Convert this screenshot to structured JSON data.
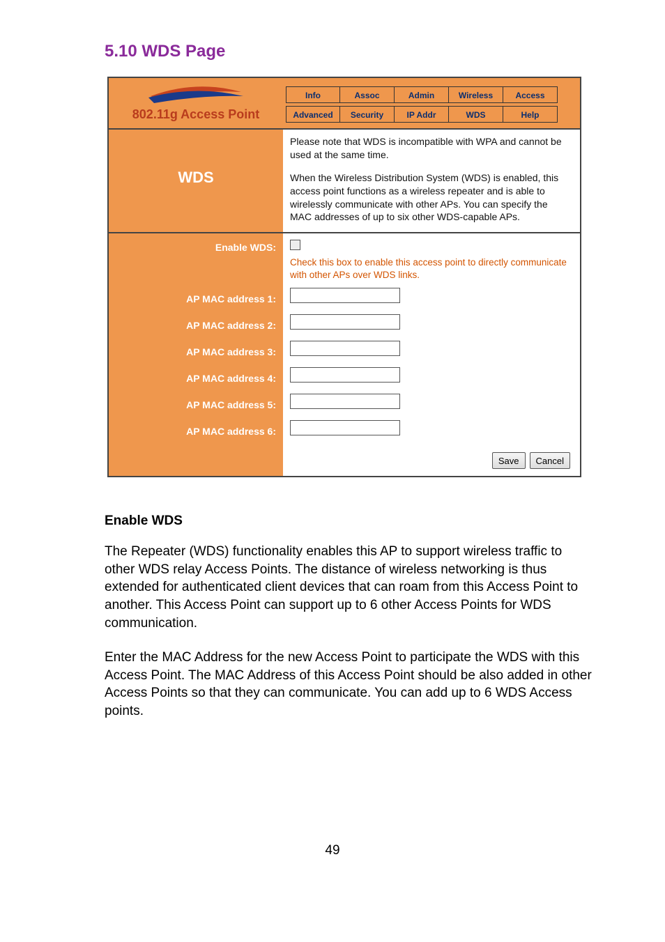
{
  "page_title": "5.10 WDS Page",
  "logo_text": "802.11g Access Point",
  "tabs": {
    "row1": [
      "Info",
      "Assoc",
      "Admin",
      "Wireless",
      "Access"
    ],
    "row2": [
      "Advanced",
      "Security",
      "IP Addr",
      "WDS",
      "Help"
    ]
  },
  "wds_section": {
    "heading": "WDS",
    "note": "Please note that WDS is incompatible with WPA and cannot be used at the same time.",
    "description": "When the Wireless Distribution System (WDS) is enabled, this access point functions as a wireless repeater and is able to wirelessly communicate with other APs. You can specify the MAC addresses of up to six other WDS-capable APs."
  },
  "form": {
    "enable_label": "Enable WDS:",
    "enable_hint": "Check this box to enable this access point to directly communicate with other APs over WDS links.",
    "mac_labels": [
      "AP MAC address 1:",
      "AP MAC address 2:",
      "AP MAC address 3:",
      "AP MAC address 4:",
      "AP MAC address 5:",
      "AP MAC address 6:"
    ],
    "mac_values": [
      "",
      "",
      "",
      "",
      "",
      ""
    ],
    "save_label": "Save",
    "cancel_label": "Cancel"
  },
  "body": {
    "heading": "Enable WDS",
    "para1": "The Repeater (WDS) functionality enables this AP to support wireless traffic to other WDS relay Access Points. The distance of wireless networking is thus extended for authenticated client devices that can roam from this Access Point to another. This Access Point can support up to 6 other Access Points for WDS communication.",
    "para2": "Enter the MAC Address for the new Access Point to participate the WDS with this Access Point. The MAC Address of this Access Point should be also added in other Access Points so that they can communicate. You can add up to 6 WDS Access points."
  },
  "page_number": "49"
}
